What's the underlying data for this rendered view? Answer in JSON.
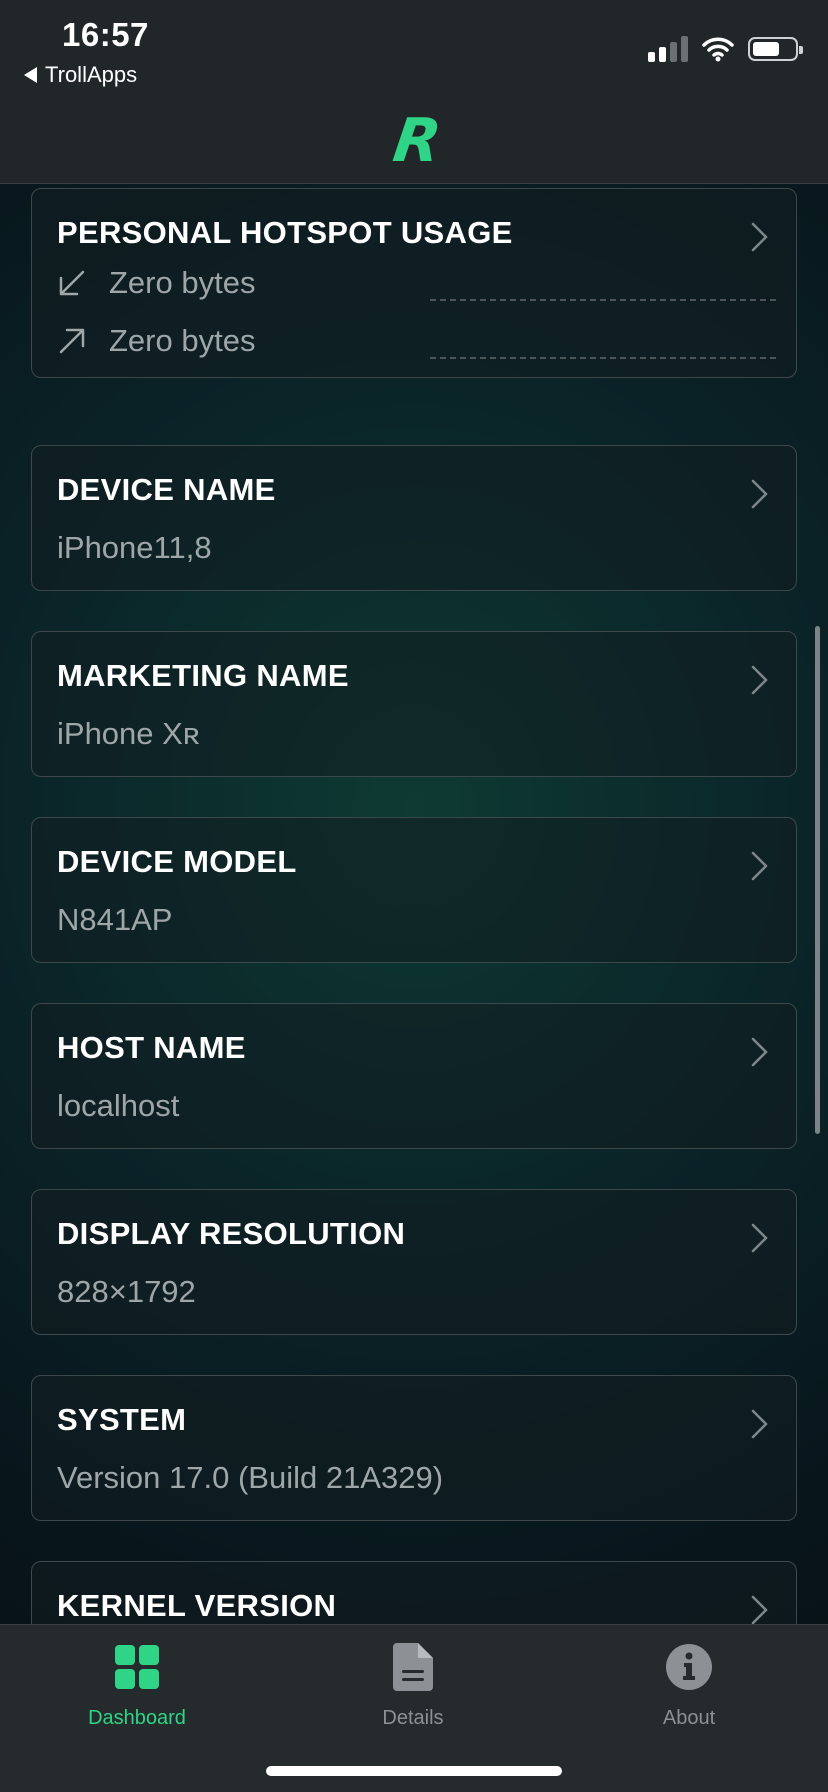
{
  "status_bar": {
    "time": "16:57",
    "back_label": "TrollApps"
  },
  "header": {
    "logo_letter": "R",
    "accent": "#2fd487"
  },
  "cards": [
    {
      "title": "PERSONAL HOTSPOT USAGE",
      "download": "Zero bytes",
      "upload": "Zero bytes",
      "download_icon": "arrow-down-left-icon",
      "upload_icon": "arrow-up-right-icon"
    },
    {
      "title": "DEVICE NAME",
      "value": "iPhone11,8"
    },
    {
      "title": "MARKETING NAME",
      "value": "iPhone Xʀ"
    },
    {
      "title": "DEVICE MODEL",
      "value": "N841AP"
    },
    {
      "title": "HOST NAME",
      "value": "localhost"
    },
    {
      "title": "DISPLAY RESOLUTION",
      "value": "828×1792"
    },
    {
      "title": "SYSTEM",
      "value": "Version 17.0 (Build 21A329)"
    },
    {
      "title": "KERNEL VERSION"
    }
  ],
  "tabs": [
    {
      "label": "Dashboard",
      "icon": "grid-icon",
      "active": true
    },
    {
      "label": "Details",
      "icon": "document-icon",
      "active": false
    },
    {
      "label": "About",
      "icon": "info-icon",
      "active": false
    }
  ]
}
